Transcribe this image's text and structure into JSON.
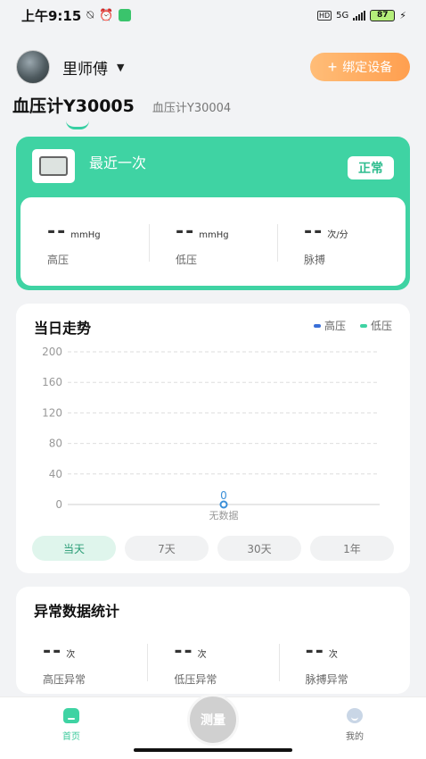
{
  "status_bar": {
    "time": "上午9:15",
    "network": "5G",
    "battery": "87"
  },
  "user": {
    "name": "里师傅",
    "bind_button": "绑定设备"
  },
  "device_tabs": [
    {
      "label": "血压计Y30005",
      "active": true
    },
    {
      "label": "血压计Y30004",
      "active": false
    }
  ],
  "latest": {
    "title": "最近一次",
    "status": "正常",
    "metrics": [
      {
        "value": "--",
        "unit": "mmHg",
        "label": "高压"
      },
      {
        "value": "--",
        "unit": "mmHg",
        "label": "低压"
      },
      {
        "value": "--",
        "unit": "次/分",
        "label": "脉搏"
      }
    ]
  },
  "trend": {
    "title": "当日走势",
    "legend": [
      {
        "label": "高压",
        "color": "#3a6fd8"
      },
      {
        "label": "低压",
        "color": "#3fd3a3"
      }
    ],
    "empty_value": "0",
    "empty_text": "无数据",
    "range_tabs": [
      {
        "label": "当天",
        "active": true
      },
      {
        "label": "7天",
        "active": false
      },
      {
        "label": "30天",
        "active": false
      },
      {
        "label": "1年",
        "active": false
      }
    ]
  },
  "chart_data": {
    "type": "line",
    "y_ticks": [
      200,
      160,
      120,
      80,
      40,
      0
    ],
    "ylim": [
      0,
      200
    ],
    "grid": true,
    "series": [
      {
        "name": "高压",
        "values": []
      },
      {
        "name": "低压",
        "values": []
      }
    ]
  },
  "abnormal": {
    "title": "异常数据统计",
    "metrics": [
      {
        "value": "--",
        "unit": "次",
        "label": "高压异常"
      },
      {
        "value": "--",
        "unit": "次",
        "label": "低压异常"
      },
      {
        "value": "--",
        "unit": "次",
        "label": "脉搏异常"
      }
    ]
  },
  "bottom_nav": {
    "home": "首页",
    "measure": "测量",
    "mine": "我的"
  },
  "colors": {
    "accent": "#3fd3a3",
    "orange": "#ff9f4f"
  }
}
